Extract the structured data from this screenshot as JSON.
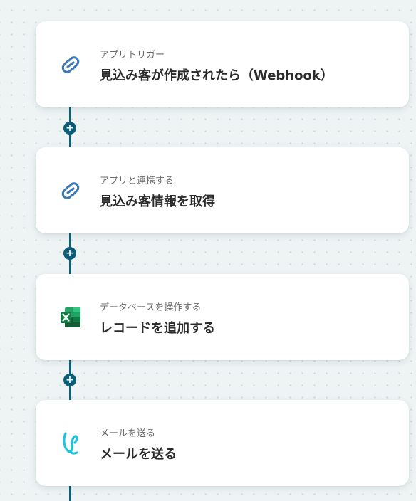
{
  "flow": {
    "steps": [
      {
        "subtitle": "アプリトリガー",
        "title": "見込み客が作成されたら（Webhook）",
        "icon": "zoho-crm-icon"
      },
      {
        "subtitle": "アプリと連携する",
        "title": "見込み客情報を取得",
        "icon": "zoho-crm-icon"
      },
      {
        "subtitle": "データベースを操作する",
        "title": "レコードを追加する",
        "icon": "excel-icon"
      },
      {
        "subtitle": "メールを送る",
        "title": "メールを送る",
        "icon": "mail-icon"
      }
    ],
    "add_symbol": "+"
  },
  "colors": {
    "connector": "#0c5f78",
    "zoho_blue": "#3a78b5",
    "excel_green": "#1e7145",
    "mail_cyan": "#1ec4dc"
  }
}
